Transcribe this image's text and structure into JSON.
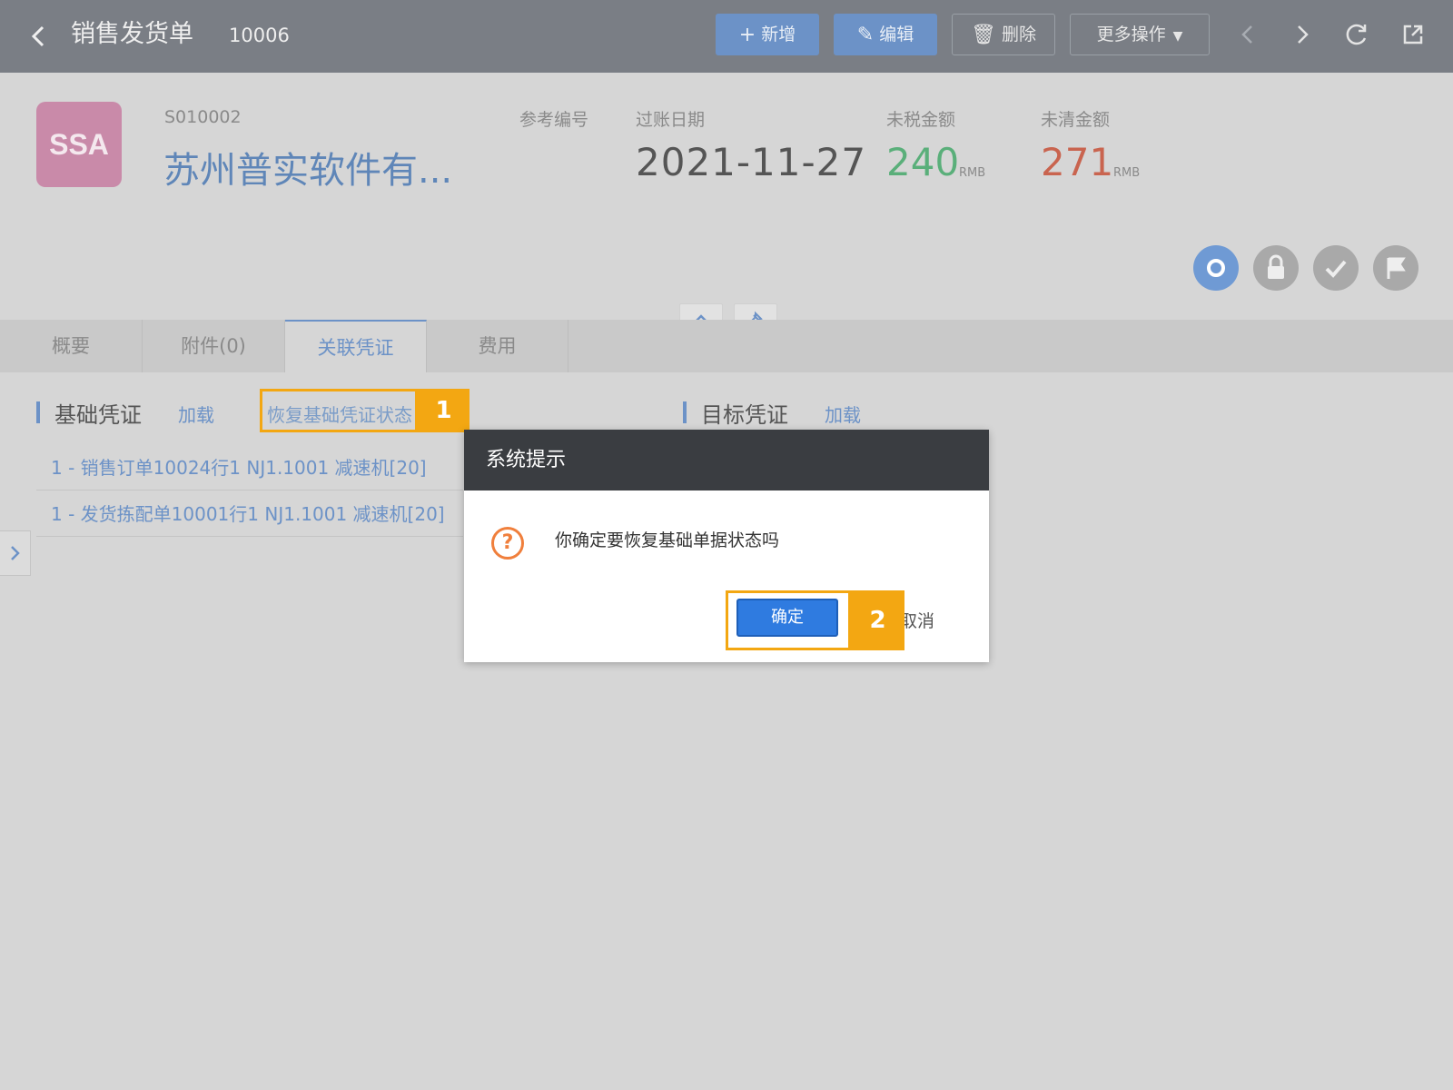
{
  "header": {
    "back_icon": "chevron-left-icon",
    "title": "销售发货单",
    "doc_number": "10006",
    "buttons": {
      "new": "新增",
      "edit": "编辑",
      "delete": "删除",
      "more": "更多操作"
    }
  },
  "summary": {
    "avatar_text": "SSA",
    "avatar_color": "#c98aa9",
    "customer_code": "S010002",
    "customer_name": "苏州普实软件有...",
    "ref_no_label": "参考编号",
    "posting_date_label": "过账日期",
    "posting_date": "2021-11-27",
    "untaxed_label": "未税金额",
    "untaxed_amount": "240",
    "untaxed_currency": "RMB",
    "outstanding_label": "未清金额",
    "outstanding_amount": "271",
    "outstanding_currency": "RMB"
  },
  "tabs": [
    {
      "label": "概要",
      "active": false
    },
    {
      "label": "附件(0)",
      "active": false
    },
    {
      "label": "关联凭证",
      "active": true
    },
    {
      "label": "费用",
      "active": false
    }
  ],
  "base_voucher": {
    "title": "基础凭证",
    "load_link": "加载",
    "restore_link": "恢复基础凭证状态",
    "lines": [
      "1 - 销售订单10024行1 NJ1.1001 减速机[20]",
      "1 - 发货拣配单10001行1 NJ1.1001 减速机[20]"
    ]
  },
  "target_voucher": {
    "title": "目标凭证",
    "load_link": "加载"
  },
  "dialog": {
    "title": "系统提示",
    "message": "你确定要恢复基础单据状态吗",
    "ok_label": "确定",
    "cancel_label": "取消"
  },
  "callouts": [
    "1",
    "2"
  ],
  "colors": {
    "accent": "#6c92c7",
    "highlight": "#f3a712",
    "amount_green": "#5aaf7a",
    "amount_red": "#c9644f",
    "ok_button": "#2f7be0"
  }
}
